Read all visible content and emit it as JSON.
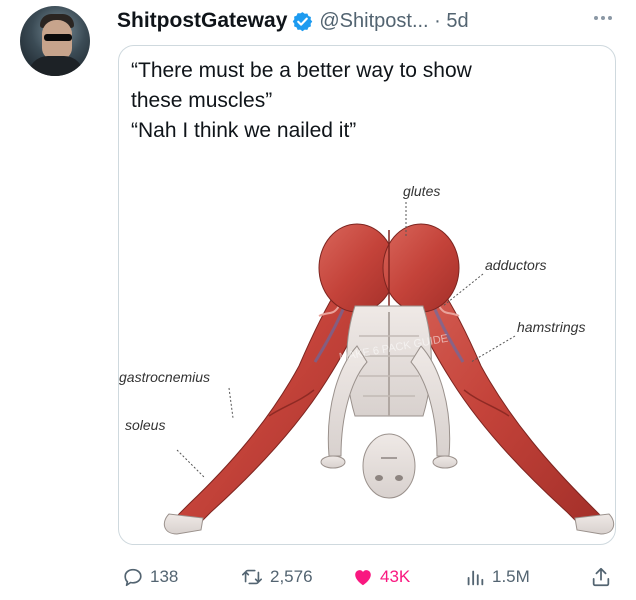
{
  "tweet": {
    "author_name": "ShitpostGateway",
    "handle_time": "@Shitpost... · 5d",
    "caption_lines": [
      "“There must be a better way to show",
      "these muscles”",
      "“Nah I think we nailed it”"
    ]
  },
  "image": {
    "labels": {
      "glutes": "glutes",
      "adductors": "adductors",
      "hamstrings": "hamstrings",
      "gastrocnemius": "gastrocnemius",
      "soleus": "soleus"
    },
    "watermark": "MAKE 6 PACK GUIDE"
  },
  "actions": {
    "replies": "138",
    "reposts": "2,576",
    "likes": "43K",
    "views": "1.5M"
  },
  "colors": {
    "like": "#f91880",
    "verified": "#1d9bf0",
    "secondary_text": "#536471",
    "muscle": "#c4433a"
  },
  "icons": [
    "reply-icon",
    "repost-icon",
    "heart-icon",
    "views-icon",
    "share-icon",
    "verified-badge-icon",
    "more-icon"
  ]
}
